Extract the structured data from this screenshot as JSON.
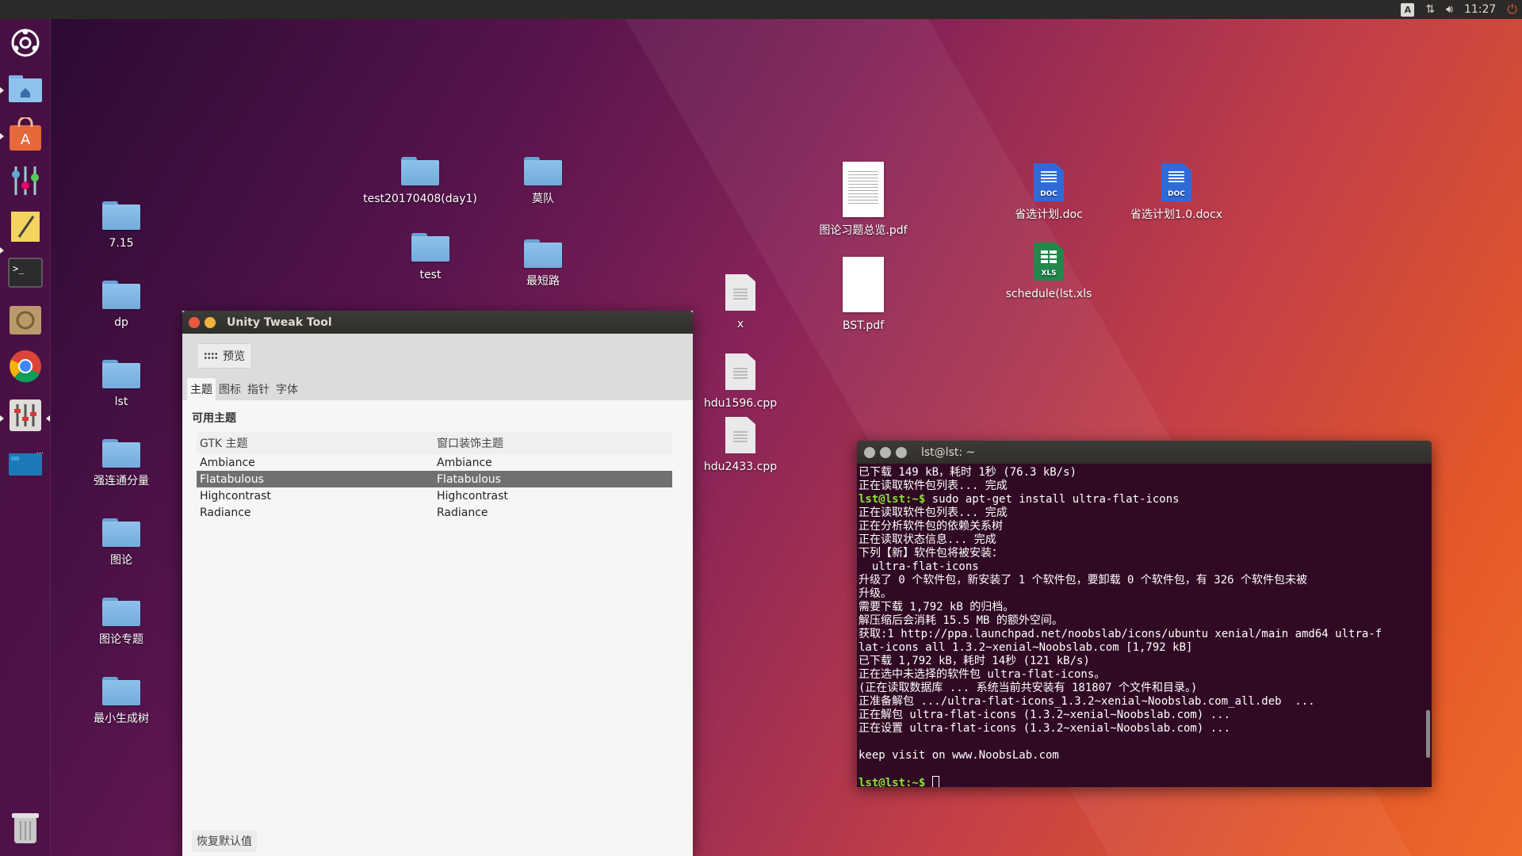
{
  "top_panel": {
    "keyboard_indicator": "A",
    "clock": "11:27"
  },
  "launcher": {
    "items": [
      "dash-icon",
      "files-icon",
      "software-center-icon",
      "settings-icon",
      "text-editor-icon",
      "terminal-icon",
      "archive-icon",
      "chrome-icon",
      "unity-tweak-icon",
      "workspace-switcher-icon",
      "trash-icon"
    ]
  },
  "desktop": {
    "left_folders": [
      "7.15",
      "dp",
      "lst",
      "强连通分量",
      "图论",
      "图论专题",
      "最小生成树"
    ],
    "top_folders": [
      "test20170408(day1)",
      "莫队",
      "test",
      "最短路"
    ],
    "files": {
      "x": "x",
      "hdu1596": "hdu1596.cpp",
      "hdu2433": "hdu2433.cpp",
      "pdf1": "图论习题总览.pdf",
      "pdf2": "BST.pdf",
      "doc1": "省选计划.doc",
      "doc2": "省选计划1.0.docx",
      "xls": "schedule(lst.xls",
      "doc_badge": "DOC",
      "xls_badge": "XLS"
    }
  },
  "unity_tweak": {
    "title": "Unity Tweak Tool",
    "preview_button": "预览",
    "tabs": [
      "主题",
      "图标",
      "指针",
      "字体"
    ],
    "section_title": "可用主题",
    "columns": [
      "GTK 主题",
      "窗口装饰主题"
    ],
    "rows": [
      [
        "Ambiance",
        "Ambiance"
      ],
      [
        "Flatabulous",
        "Flatabulous"
      ],
      [
        "Highcontrast",
        "Highcontrast"
      ],
      [
        "Radiance",
        "Radiance"
      ]
    ],
    "selected_row": 1,
    "restore_button": "恢复默认值"
  },
  "terminal": {
    "title": "lst@lst: ~",
    "lines": [
      "已下载 149 kB，耗时 1秒 (76.3 kB/s)",
      "正在读取软件包列表... 完成",
      "__PROMPT__sudo apt-get install ultra-flat-icons",
      "正在读取软件包列表... 完成",
      "正在分析软件包的依赖关系树",
      "正在读取状态信息... 完成",
      "下列【新】软件包将被安装：",
      "  ultra-flat-icons",
      "升级了 0 个软件包，新安装了 1 个软件包，要卸载 0 个软件包，有 326 个软件包未被",
      "升级。",
      "需要下载 1,792 kB 的归档。",
      "解压缩后会消耗 15.5 MB 的额外空间。",
      "获取:1 http://ppa.launchpad.net/noobslab/icons/ubuntu xenial/main amd64 ultra-f",
      "lat-icons all 1.3.2~xenial~Noobslab.com [1,792 kB]",
      "已下载 1,792 kB，耗时 14秒 (121 kB/s)",
      "正在选中未选择的软件包 ultra-flat-icons。",
      "(正在读取数据库 ... 系统当前共安装有 181807 个文件和目录。)",
      "正准备解包 .../ultra-flat-icons_1.3.2~xenial~Noobslab.com_all.deb  ...",
      "正在解包 ultra-flat-icons (1.3.2~xenial~Noobslab.com) ...",
      "正在设置 ultra-flat-icons (1.3.2~xenial~Noobslab.com) ...",
      "",
      "keep visit on www.NoobsLab.com",
      "",
      "__PROMPT__"
    ],
    "prompt": "lst@lst:~$ "
  }
}
